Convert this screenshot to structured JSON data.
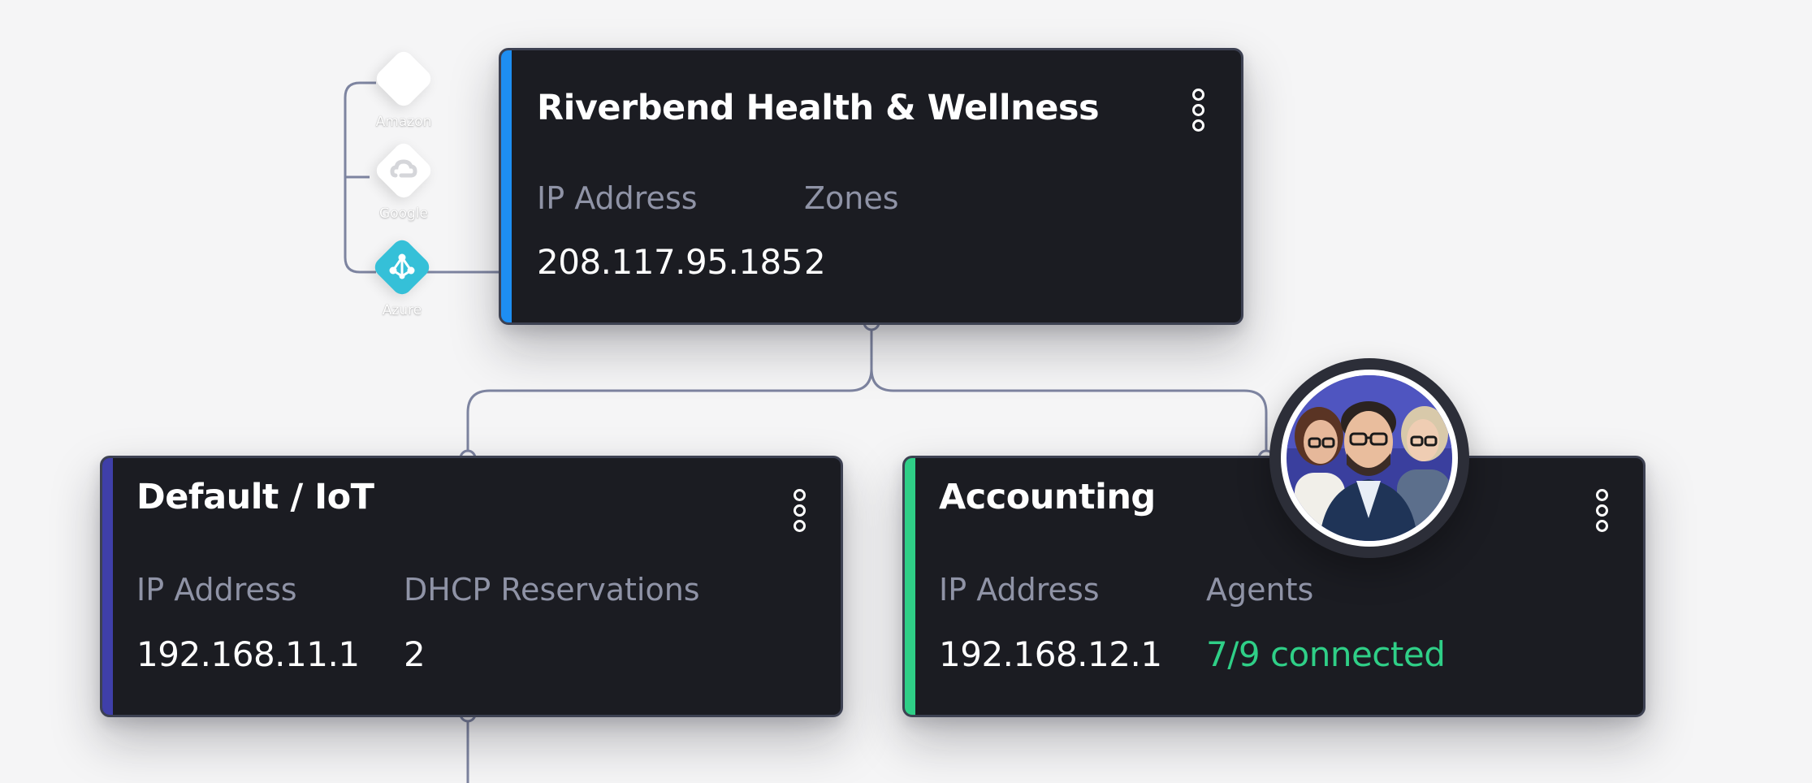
{
  "providers": [
    {
      "label": "Amazon",
      "icon": "amazon-icon"
    },
    {
      "label": "Google",
      "icon": "google-cloud-icon"
    },
    {
      "label": "Azure",
      "icon": "azure-icon"
    }
  ],
  "colors": {
    "card_bg": "#1b1c22",
    "card_border": "#3d4152",
    "connector": "#7d84a0",
    "accent_root": "#1e8ef2",
    "accent_iot": "#3f3fa9",
    "accent_accounting": "#2fcf87",
    "agents_connected": "#2fcf87",
    "azure": "#35c0d8"
  },
  "root": {
    "title": "Riverbend Health & Wellness",
    "fields": [
      {
        "label": "IP Address",
        "value": "208.117.95.185"
      },
      {
        "label": "Zones",
        "value": "2"
      }
    ],
    "menu_icon": "more-vertical-icon"
  },
  "zones": [
    {
      "title": "Default / IoT",
      "fields": [
        {
          "label": "IP Address",
          "value": "192.168.11.1"
        },
        {
          "label": "DHCP Reservations",
          "value": "2"
        }
      ],
      "menu_icon": "more-vertical-icon"
    },
    {
      "title": "Accounting",
      "fields": [
        {
          "label": "IP Address",
          "value": "192.168.12.1"
        },
        {
          "label": "Agents",
          "value": "7/9 connected"
        }
      ],
      "menu_icon": "more-vertical-icon",
      "avatar_icon": "group-avatar-icon"
    }
  ]
}
